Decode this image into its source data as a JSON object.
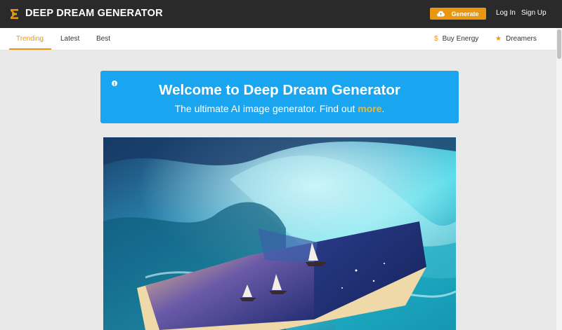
{
  "header": {
    "brand": "DEEP DREAM GENERATOR",
    "generate_label": "Generate",
    "login_label": "Log In",
    "signup_label": "Sign Up",
    "accent_color": "#e8970f"
  },
  "subnav": {
    "tabs": [
      {
        "label": "Trending",
        "active": true
      },
      {
        "label": "Latest",
        "active": false
      },
      {
        "label": "Best",
        "active": false
      }
    ],
    "buy_energy_icon": "$",
    "buy_energy_label": "Buy Energy",
    "dreamers_icon": "★",
    "dreamers_label": "Dreamers"
  },
  "banner": {
    "title": "Welcome to Deep Dream Generator",
    "subtitle_prefix": "The ultimate AI image generator. Find out ",
    "subtitle_link": "more",
    "subtitle_suffix": ".",
    "info_icon": "i",
    "color": "#1aa5f0"
  },
  "feed": {
    "image_description": "open book with sailing ships amid turquoise ocean waves"
  }
}
